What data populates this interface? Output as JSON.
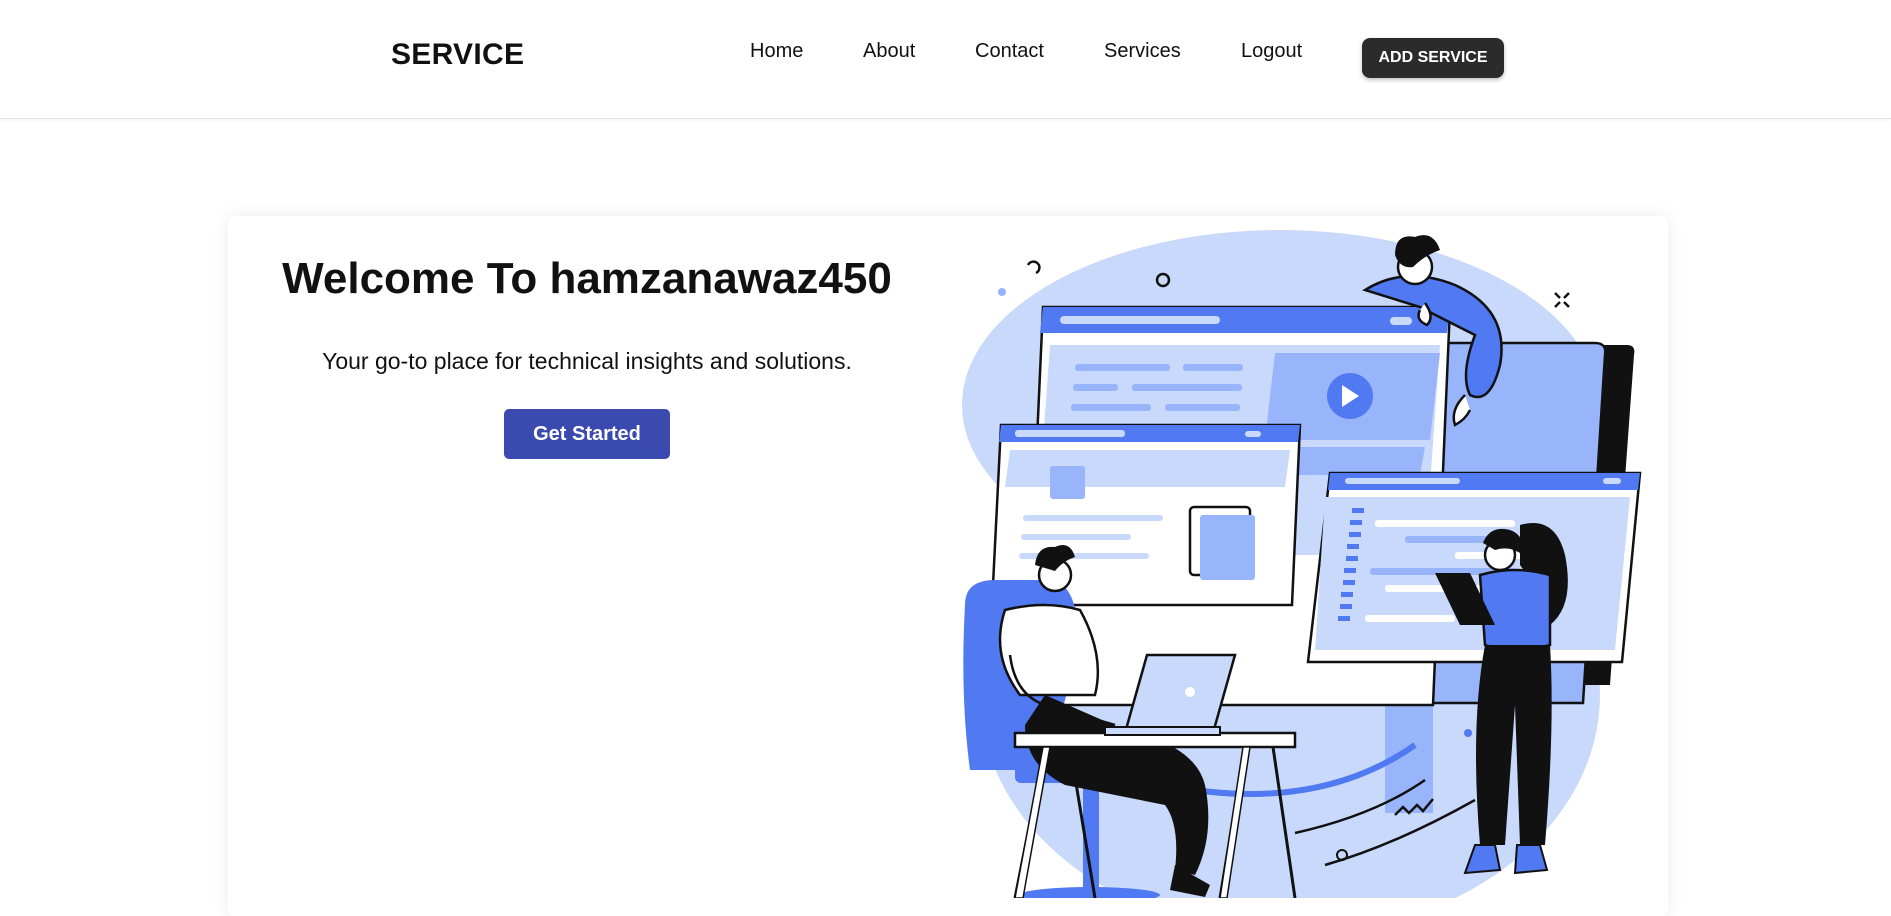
{
  "navbar": {
    "brand": "SERVICE",
    "links": [
      {
        "label": "Home"
      },
      {
        "label": "About"
      },
      {
        "label": "Contact"
      },
      {
        "label": "Services"
      },
      {
        "label": "Logout"
      }
    ],
    "add_button_label": "ADD SERVICE"
  },
  "hero": {
    "title": "Welcome To hamzanawaz450",
    "subtitle": "Your go-to place for technical insights and solutions.",
    "cta_label": "Get Started"
  },
  "colors": {
    "accent": "#3a4aae",
    "dark_button": "#2b2b2b",
    "illustration_blue": "#5079f2",
    "illustration_light": "#c9d9fc",
    "illustration_mid": "#98b4fb"
  },
  "icons": {
    "illustration": "team-working-on-web-screens-illustration",
    "play": "play-icon"
  }
}
